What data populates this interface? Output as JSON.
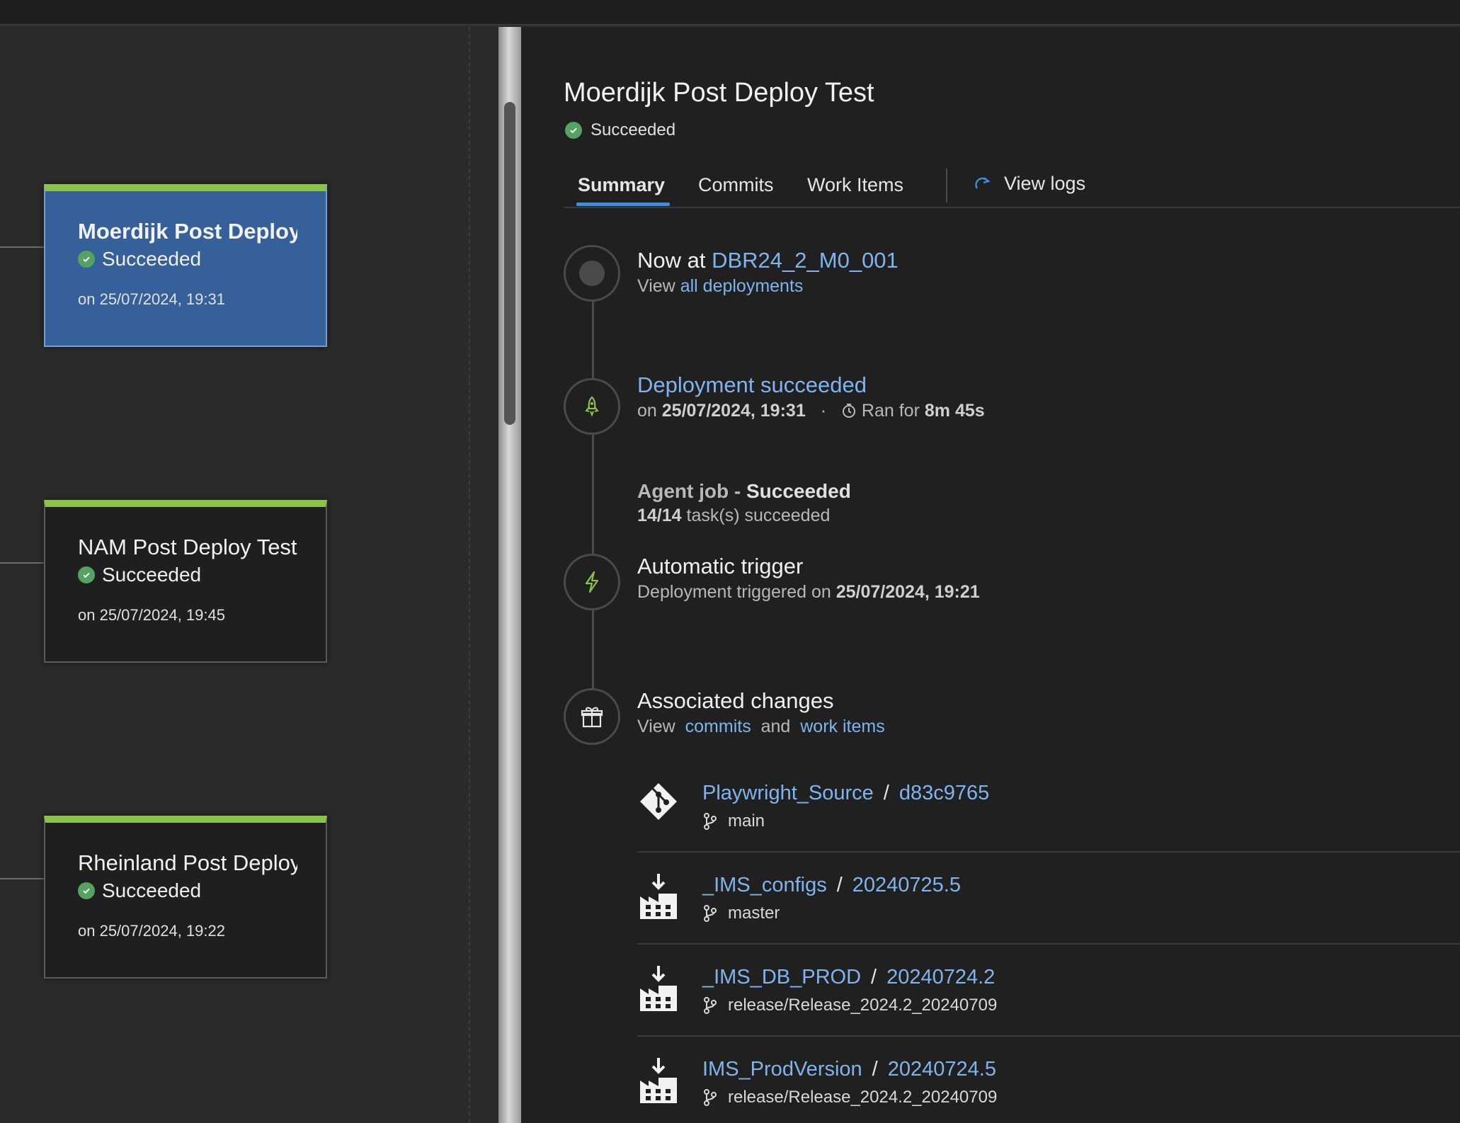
{
  "stages": [
    {
      "title": "Moerdijk Post Deploy Test",
      "status": "Succeeded",
      "date": "on 25/07/2024, 19:31",
      "selected": true
    },
    {
      "title": "NAM Post Deploy Test",
      "status": "Succeeded",
      "date": "on 25/07/2024, 19:45",
      "selected": false
    },
    {
      "title": "Rheinland Post Deploy Test",
      "status": "Succeeded",
      "date": "on 25/07/2024, 19:22",
      "selected": false
    }
  ],
  "panel": {
    "title": "Moerdijk Post Deploy Test",
    "status": "Succeeded",
    "tabs": [
      "Summary",
      "Commits",
      "Work Items"
    ],
    "active_tab": "Summary",
    "view_logs": "View logs"
  },
  "now_at": {
    "prefix": "Now at",
    "release": "DBR24_2_M0_001",
    "view_prefix": "View",
    "view_link": "all deployments"
  },
  "deployment": {
    "title": "Deployment succeeded",
    "on_label": "on",
    "date": "25/07/2024, 19:31",
    "ran_label": "Ran for",
    "duration": "8m 45s"
  },
  "agent_job": {
    "label": "Agent job - ",
    "status": "Succeeded",
    "count": "14/14",
    "count_suffix": "task(s) succeeded"
  },
  "trigger": {
    "title": "Automatic trigger",
    "prefix": "Deployment triggered on",
    "date": "25/07/2024, 19:21"
  },
  "changes": {
    "title": "Associated changes",
    "view_prefix": "View",
    "commits_link": "commits",
    "and": "and",
    "work_items_link": "work items"
  },
  "artifacts": [
    {
      "name": "Playwright_Source",
      "version": "d83c9765",
      "branch": "main",
      "icon": "git-icon"
    },
    {
      "name": "_IMS_configs",
      "version": "20240725.5",
      "branch": "master",
      "icon": "build-artifact-icon"
    },
    {
      "name": "_IMS_DB_PROD",
      "version": "20240724.2",
      "branch": "release/Release_2024.2_20240709",
      "icon": "build-artifact-icon"
    },
    {
      "name": "IMS_ProdVersion",
      "version": "20240724.5",
      "branch": "release/Release_2024.2_20240709",
      "icon": "build-artifact-icon"
    }
  ],
  "colors": {
    "accent": "#3b8fe0",
    "success": "#55a362",
    "link": "#7fb4ee",
    "stage_selected": "#36609a",
    "stage_bar": "#8bc34a"
  }
}
